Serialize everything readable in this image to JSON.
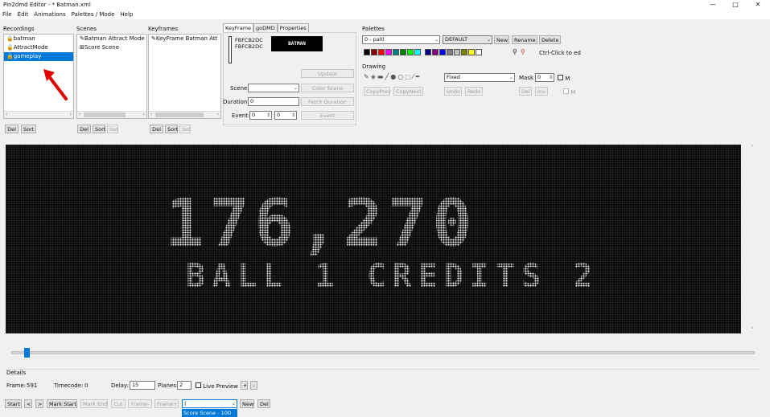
{
  "window": {
    "title": "Pin2dmd Editor - * Batman.xml",
    "minimize": "—",
    "maximize": "□",
    "close": "✕"
  },
  "menu": [
    "File",
    "Edit",
    "Animations",
    "Palettes / Mode",
    "Help"
  ],
  "recordings": {
    "label": "Recordings",
    "items": [
      "batman",
      "AttractMode",
      "gameplay"
    ],
    "selected_index": 2,
    "del": "Del",
    "sort": "Sort"
  },
  "scenes": {
    "label": "Scenes",
    "items": [
      "Batman Attract Mode",
      "Score Scene"
    ],
    "del": "Del",
    "sort": "Sort",
    "set": "Set"
  },
  "keyframes": {
    "label": "Keyframes",
    "items": [
      "KeyFrame Batman Att"
    ],
    "del": "Del",
    "sort": "Sort",
    "set": "Set"
  },
  "tabs": [
    "KeyFrame",
    "goDMD",
    "Properties"
  ],
  "keyframe_panel": {
    "hash1": "FBFCB2DC",
    "hash2": "FBFCB2DC",
    "preview_text": "BATMAN",
    "update_btn": "Update",
    "scene_label": "Scene:",
    "color_scene_btn": "Color Scene",
    "duration_label": "Duration:",
    "duration_value": "0",
    "fetch_duration_btn": "Fetch Duration",
    "event_label": "Event:",
    "event_value1": "0",
    "event_value2": "0",
    "event_btn": "Event"
  },
  "palettes": {
    "label": "Palettes",
    "selected": "0 - pal0",
    "type": "DEFAULT",
    "new": "New",
    "rename": "Rename",
    "delete": "Delete",
    "hint": "Ctrl-Click to ed",
    "swatches": [
      "#000000",
      "#8b0000",
      "#ff0000",
      "#ff00ff",
      "#008080",
      "#008000",
      "#00ff00",
      "#00ffff",
      "#000080",
      "#800080",
      "#0000ff",
      "#808080",
      "#c0c0c0",
      "#808000",
      "#ffff00",
      "#ffffff"
    ]
  },
  "drawing": {
    "label": "Drawing",
    "fill_mode": "Fixed",
    "mask_label": "Mask",
    "mask_value": "0",
    "m_label": "M",
    "copy_prev": "CopyPrev",
    "copy_next": "CopyNext",
    "undo": "Undo",
    "redo": "Redo",
    "del": "Del",
    "inv": "Inv"
  },
  "dmd": {
    "score": "176,270",
    "line2": "BALL 1  CREDITS 2"
  },
  "details": {
    "label": "Details",
    "frame_label": "Frame:",
    "frame_value": "591",
    "timecode_label": "Timecode:",
    "timecode_value": "0",
    "delay_label": "Delay:",
    "delay_value": "15",
    "planes_label": "Planes:",
    "planes_value": "2",
    "live_preview": "Live Preview",
    "plus": "+",
    "minus": "-"
  },
  "bottom": {
    "start": "Start",
    "prev": "<",
    "next": ">",
    "mark_start": "Mark Start",
    "mark_end": "Mark End",
    "cut": "Cut",
    "frame_minus": "Frame-",
    "frame_plus": "Frame+",
    "new": "New",
    "del": "Del",
    "dropdown_option": "Score Scene - 100"
  }
}
